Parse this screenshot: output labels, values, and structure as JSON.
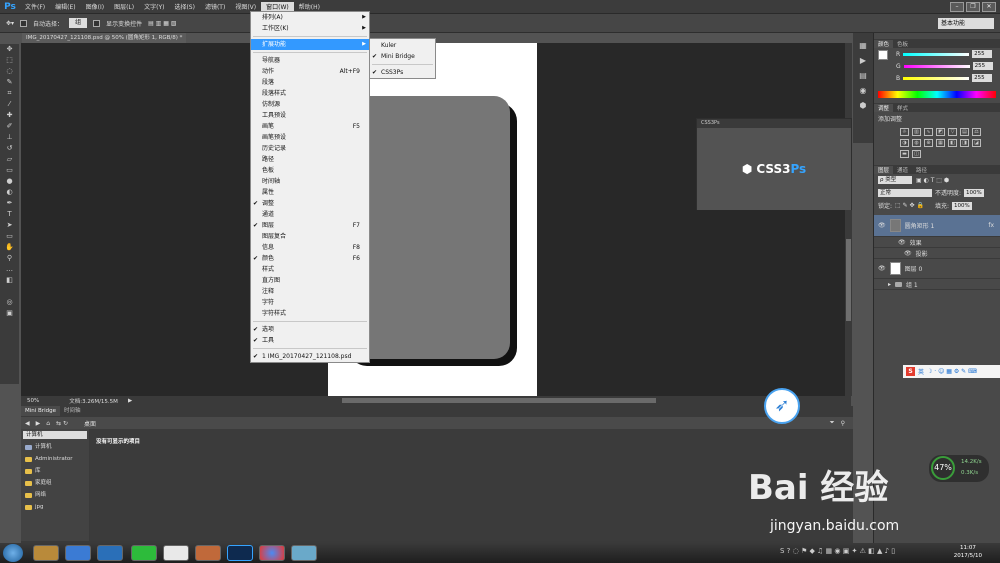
{
  "app": {
    "logo": "Ps"
  },
  "menubar": [
    "文件(F)",
    "编辑(E)",
    "图像(I)",
    "图层(L)",
    "文字(Y)",
    "选择(S)",
    "滤镜(T)",
    "视图(V)",
    "窗口(W)",
    "帮助(H)"
  ],
  "options": {
    "auto_select": "自动选择：",
    "auto_select_value": "组",
    "show_transform": "显示变换控件",
    "workspace": "基本功能"
  },
  "doc_tab": "IMG_20170427_121108.psd @ 50% (圆角矩形 1, RGB/8) *",
  "status": {
    "zoom": "50%",
    "doc": "文档:3.26M/15.5M"
  },
  "window_menu": [
    {
      "label": "排列(A)",
      "arrow": true
    },
    {
      "label": "工作区(K)",
      "arrow": true
    },
    {
      "sep": true
    },
    {
      "label": "扩展功能",
      "arrow": true,
      "highlight": true
    },
    {
      "sep": true
    },
    {
      "label": "导航器"
    },
    {
      "label": "动作",
      "shortcut": "Alt+F9"
    },
    {
      "label": "段落"
    },
    {
      "label": "段落样式"
    },
    {
      "label": "仿制源"
    },
    {
      "label": "工具预设"
    },
    {
      "label": "画笔",
      "shortcut": "F5"
    },
    {
      "label": "画笔预设"
    },
    {
      "label": "历史记录"
    },
    {
      "label": "路径"
    },
    {
      "label": "色板"
    },
    {
      "label": "时间轴"
    },
    {
      "label": "属性"
    },
    {
      "label": "调整",
      "check": true
    },
    {
      "label": "通道"
    },
    {
      "label": "图层",
      "check": true,
      "shortcut": "F7"
    },
    {
      "label": "图层复合"
    },
    {
      "label": "信息",
      "shortcut": "F8"
    },
    {
      "label": "颜色",
      "check": true,
      "shortcut": "F6"
    },
    {
      "label": "样式"
    },
    {
      "label": "直方图"
    },
    {
      "label": "注释"
    },
    {
      "label": "字符"
    },
    {
      "label": "字符样式"
    },
    {
      "sep": true
    },
    {
      "label": "选项",
      "check": true
    },
    {
      "label": "工具",
      "check": true
    },
    {
      "sep": true
    },
    {
      "label": "1 IMG_20170427_121108.psd",
      "check": true
    }
  ],
  "extensions_submenu": [
    {
      "label": "Kuler",
      "check": false
    },
    {
      "label": "Mini Bridge",
      "check": true
    },
    {
      "sep": true
    },
    {
      "label": "CSS3Ps",
      "check": true
    }
  ],
  "css3ps": {
    "title": "CSS3Ps",
    "logo_a": "CSS3",
    "logo_b": "Ps"
  },
  "color_panel": {
    "tabs": [
      "颜色",
      "色板"
    ],
    "r": "255",
    "g": "255",
    "b": "255",
    "r_label": "R",
    "g_label": "G",
    "b_label": "B"
  },
  "adjust_panel": {
    "tabs": [
      "调整",
      "样式"
    ],
    "title": "添加调整"
  },
  "layers_panel": {
    "tabs": [
      "图层",
      "通道",
      "路径"
    ],
    "filter": "ρ 类型",
    "blend": "正常",
    "opacity_label": "不透明度:",
    "opacity": "100%",
    "lock_label": "锁定:",
    "fill_label": "填充:",
    "fill": "100%",
    "layers": [
      {
        "name": "圆角矩形 1",
        "fx": "fx",
        "selected": true
      },
      {
        "name": "效果",
        "sub": true
      },
      {
        "name": "投影",
        "sub": true
      },
      {
        "name": "图层 0"
      },
      {
        "name": "组 1"
      }
    ]
  },
  "mini_bridge": {
    "tabs": [
      "Mini Bridge",
      "时间轴"
    ],
    "path": "桌面",
    "source": "计算机",
    "tree": [
      "计算机",
      "Administrator",
      "库",
      "家庭组",
      "网络",
      "jpg"
    ],
    "message": "没有可显示的项目"
  },
  "perf": {
    "cpu": "47%",
    "up": "14.2K/s",
    "down": "0.3K/s"
  },
  "ime": {
    "logo": "S",
    "mode": "英"
  },
  "watermark": {
    "brand": "Bai 经验",
    "url": "jingyan.baidu.com"
  },
  "clock": {
    "time": "11:07",
    "date": "2017/5/10"
  }
}
